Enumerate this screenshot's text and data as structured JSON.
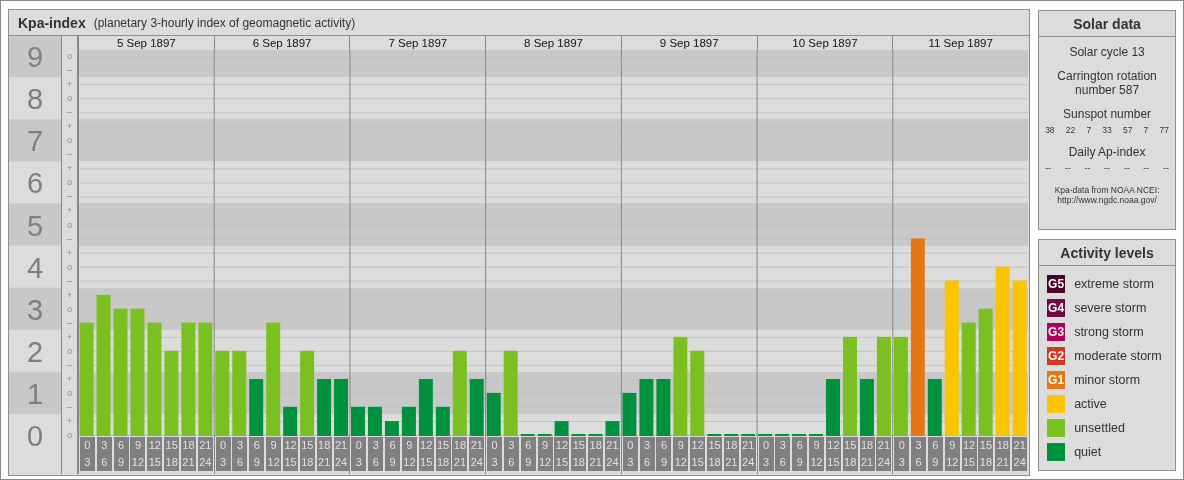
{
  "kpa_panel": {
    "title": "Kpa-index",
    "subtitle": "(planetary 3-hourly index of geomagnetic activity)",
    "dates": [
      "5 Sep 1897",
      "6 Sep 1897",
      "7 Sep 1897",
      "8 Sep 1897",
      "9 Sep 1897",
      "10 Sep 1897",
      "11 Sep 1897"
    ],
    "minor_tick_labels": [
      "o",
      "–",
      "+",
      "o",
      "–",
      "+",
      "o",
      "–",
      "+",
      "o",
      "–",
      "+",
      "o",
      "–",
      "+",
      "o",
      "–",
      "+",
      "o",
      "–",
      "+",
      "o",
      "–",
      "+",
      "o",
      "–",
      "+",
      "o"
    ],
    "chart_data": {
      "type": "bar",
      "grid": true,
      "categories": [
        "0 3",
        "3 6",
        "6 9",
        "9 12",
        "12 15",
        "15 18",
        "18 21",
        "21 24",
        "0 3",
        "3 6",
        "6 9",
        "9 12",
        "12 15",
        "15 18",
        "18 21",
        "21 24",
        "0 3",
        "3 6",
        "6 9",
        "9 12",
        "12 15",
        "15 18",
        "18 21",
        "21 24",
        "0 3",
        "3 6",
        "6 9",
        "9 12",
        "12 15",
        "15 18",
        "18 21",
        "21 24",
        "0 3",
        "3 6",
        "6 9",
        "9 12",
        "12 15",
        "15 18",
        "18 21",
        "21 24",
        "0 3",
        "3 6",
        "6 9",
        "9 12",
        "12 15",
        "15 18",
        "18 21",
        "21 24",
        "0 3",
        "3 6",
        "6 9",
        "9 12",
        "12 15",
        "15 18",
        "18 21",
        "21 24"
      ],
      "series": [
        {
          "values": [
            2.67,
            3.33,
            3,
            3,
            2.67,
            2,
            2.67,
            2.67,
            2,
            2,
            1.33,
            2.67,
            0.67,
            2,
            1.33,
            1.33,
            0.67,
            0.67,
            0.33,
            0.67,
            1.33,
            0.67,
            2,
            1.33,
            1,
            2,
            0,
            0,
            0.33,
            0,
            0,
            0.33,
            1,
            1.33,
            1.33,
            2.33,
            2,
            0,
            0,
            0,
            0,
            0,
            0,
            0,
            1.33,
            2.33,
            1.33,
            2.33,
            2.33,
            4.67,
            1.33,
            3.67,
            2.67,
            3,
            4,
            3.67
          ]
        }
      ],
      "ylim": [
        0,
        9.17
      ],
      "yticks": [
        {
          "value": 0,
          "label": "0"
        },
        {
          "value": 1,
          "label": "1"
        },
        {
          "value": 2,
          "label": "2"
        },
        {
          "value": 3,
          "label": "3"
        },
        {
          "value": 4,
          "label": "4"
        },
        {
          "value": 5,
          "label": "5"
        },
        {
          "value": 6,
          "label": "6"
        },
        {
          "value": 7,
          "label": "7"
        },
        {
          "value": 8,
          "label": "8"
        },
        {
          "value": 9,
          "label": "9"
        }
      ]
    }
  },
  "solar_data": {
    "title": "Solar data",
    "solar_cycle": "Solar cycle 13",
    "carrington": "Carrington rotation number 587",
    "sunspot_label": "Sunspot number",
    "sunspot_numbers": [
      "38",
      "22",
      "7",
      "33",
      "57",
      "7",
      "77"
    ],
    "ap_label": "Daily Ap-index",
    "ap_values": [
      "--",
      "--",
      "--",
      "--",
      "--",
      "--",
      "--"
    ],
    "source_note": "Kpa-data from NOAA NCEI:",
    "source_url": "http://www.ngdc.noaa.gov/"
  },
  "legend": {
    "title": "Activity levels",
    "items": [
      {
        "badge": "G5",
        "label": "extreme storm",
        "color": "#4b0027"
      },
      {
        "badge": "G4",
        "label": "severe storm",
        "color": "#6e0a45"
      },
      {
        "badge": "G3",
        "label": "strong storm",
        "color": "#b0005e"
      },
      {
        "badge": "G2",
        "label": "moderate storm",
        "color": "#d4351c"
      },
      {
        "badge": "G1",
        "label": "minor storm",
        "color": "#e57716"
      },
      {
        "label": "active",
        "color": "#f9c400"
      },
      {
        "label": "unsettled",
        "color": "#7bc021"
      },
      {
        "label": "quiet",
        "color": "#00913f"
      }
    ]
  }
}
